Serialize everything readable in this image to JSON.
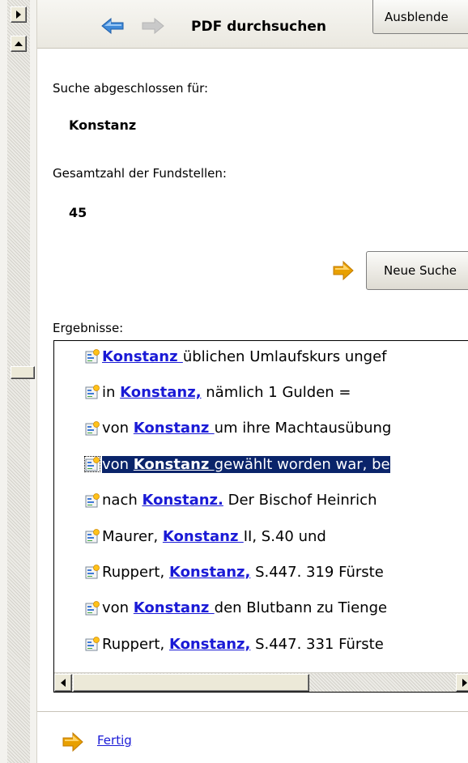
{
  "header": {
    "title": "PDF durchsuchen",
    "hide_button": "Ausblende",
    "back_icon": "arrow-left-icon",
    "forward_icon": "arrow-right-icon"
  },
  "search": {
    "completed_label": "Suche abgeschlossen für:",
    "query": "Konstanz",
    "total_label": "Gesamtzahl der Fundstellen:",
    "total_count": "45",
    "new_search_button": "Neue Suche"
  },
  "results": {
    "label": "Ergebnisse:",
    "items": [
      {
        "before": "",
        "term": "Konstanz ",
        "after": "üblichen Umlaufskurs ungef"
      },
      {
        "before": "in ",
        "term": "Konstanz,",
        "after": " nämlich 1 Gulden ="
      },
      {
        "before": "von ",
        "term": "Konstanz ",
        "after": "um ihre Machtausübung"
      },
      {
        "before": "von ",
        "term": "Konstanz ",
        "after": "gewählt worden war, be"
      },
      {
        "before": "nach ",
        "term": "Konstanz.",
        "after": " Der Bischof Heinrich"
      },
      {
        "before": "Maurer, ",
        "term": "Konstanz ",
        "after": "II, S.40 und"
      },
      {
        "before": "Ruppert, ",
        "term": "Konstanz,",
        "after": " S.447. 319 Fürste"
      },
      {
        "before": "von ",
        "term": "Konstanz ",
        "after": "den Blutbann zu Tienge"
      },
      {
        "before": "Ruppert, ",
        "term": "Konstanz,",
        "after": " S.447. 331 Fürste"
      }
    ],
    "selected_index": 3
  },
  "footer": {
    "done_link": "Fertig"
  },
  "colors": {
    "link": "#1a1ad6",
    "selection": "#0a246a",
    "arrow": "#e8a000"
  }
}
